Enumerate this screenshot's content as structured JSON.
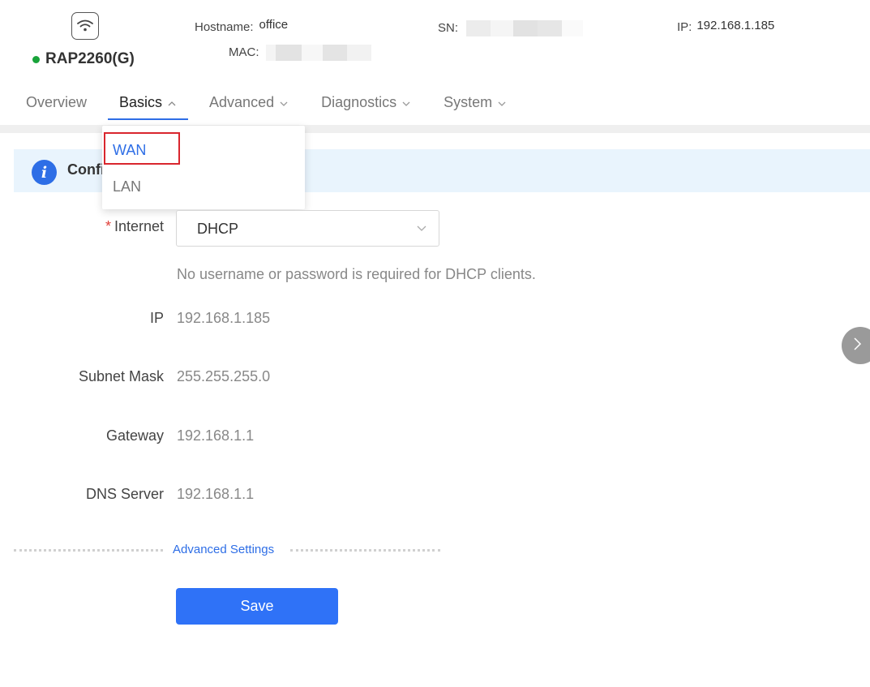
{
  "device": {
    "model": "RAP2260(G)",
    "status_color": "#18a33a",
    "icon": "wifi-icon"
  },
  "header": {
    "hostname_label": "Hostname:",
    "hostname_value": "office",
    "sn_label": "SN:",
    "mac_label": "MAC:",
    "ip_label": "IP:",
    "ip_value": "192.168.1.185"
  },
  "nav": {
    "tabs": [
      {
        "label": "Overview"
      },
      {
        "label": "Basics",
        "active": true,
        "icon": "chevron-up-icon"
      },
      {
        "label": "Advanced",
        "icon": "chevron-down-icon"
      },
      {
        "label": "Diagnostics",
        "icon": "chevron-down-icon"
      },
      {
        "label": "System",
        "icon": "chevron-down-icon"
      }
    ]
  },
  "basics_menu": {
    "items": [
      {
        "label": "WAN",
        "selected": true
      },
      {
        "label": "LAN"
      }
    ]
  },
  "banner": {
    "icon": "info-icon",
    "text": "Confi"
  },
  "form": {
    "internet": {
      "label": "Internet",
      "required_mark": "*",
      "value": "DHCP"
    },
    "hint": "No username or password is required for DHCP clients.",
    "ip": {
      "label": "IP",
      "value": "192.168.1.185"
    },
    "subnet": {
      "label": "Subnet Mask",
      "value": "255.255.255.0"
    },
    "gateway": {
      "label": "Gateway",
      "value": "192.168.1.1"
    },
    "dns": {
      "label": "DNS Server",
      "value": "192.168.1.1"
    },
    "advanced_link": "Advanced Settings",
    "save_label": "Save"
  },
  "colors": {
    "accent": "#2e6ee6",
    "highlight_box": "#d9262e",
    "banner_bg": "#e9f4fd"
  }
}
